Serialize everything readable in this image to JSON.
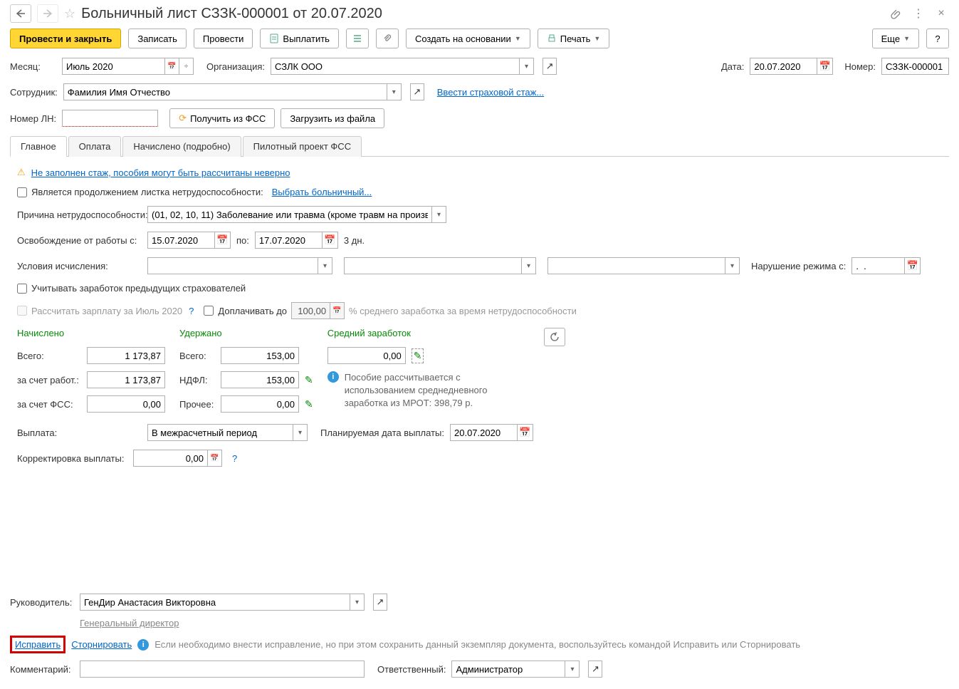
{
  "header": {
    "title": "Больничный лист СЗЗК-000001 от 20.07.2020"
  },
  "toolbar": {
    "post_close": "Провести и закрыть",
    "save": "Записать",
    "post": "Провести",
    "pay": "Выплатить",
    "create_based": "Создать на основании",
    "print": "Печать",
    "more": "Еще"
  },
  "fields": {
    "month_label": "Месяц:",
    "month_value": "Июль 2020",
    "org_label": "Организация:",
    "org_value": "СЗЛК ООО",
    "date_label": "Дата:",
    "date_value": "20.07.2020",
    "number_label": "Номер:",
    "number_value": "СЗЗК-000001",
    "employee_label": "Сотрудник:",
    "employee_value": "Фамилия Имя Отчество",
    "insurance_link": "Ввести страховой стаж...",
    "ln_label": "Номер ЛН:",
    "get_fss": "Получить из ФСС",
    "load_file": "Загрузить из файла"
  },
  "tabs": {
    "main": "Главное",
    "payment": "Оплата",
    "accrued": "Начислено (подробно)",
    "pilot": "Пилотный проект ФСС"
  },
  "main_tab": {
    "warning": "Не заполнен стаж, пособия могут быть рассчитаны неверно",
    "continuation_label": "Является продолжением листка нетрудоспособности:",
    "select_sick": "Выбрать больничный...",
    "reason_label": "Причина нетрудоспособности:",
    "reason_value": "(01, 02, 10, 11) Заболевание или травма (кроме травм на произв",
    "release_label": "Освобождение от работы с:",
    "release_from": "15.07.2020",
    "to_label": "по:",
    "release_to": "17.07.2020",
    "days": "3 дн.",
    "calc_conditions": "Условия исчисления:",
    "violation_label": "Нарушение режима с:",
    "violation_value": ".  .",
    "prev_employers": "Учитывать заработок предыдущих страхователей",
    "calc_salary": "Рассчитать зарплату за Июль 2020",
    "topup_label": "Доплачивать до",
    "topup_value": "100,00",
    "topup_suffix": "% среднего заработка за время нетрудоспособности"
  },
  "totals": {
    "accrued_hdr": "Начислено",
    "held_hdr": "Удержано",
    "avg_hdr": "Средний заработок",
    "total_label": "Всего:",
    "employer_label": "за счет работ.:",
    "fss_label": "за счет ФСС:",
    "ndfl_label": "НДФЛ:",
    "other_label": "Прочее:",
    "accrued_total": "1 173,87",
    "accrued_employer": "1 173,87",
    "accrued_fss": "0,00",
    "held_total": "153,00",
    "held_ndfl": "153,00",
    "held_other": "0,00",
    "avg_value": "0,00",
    "info_text": "Пособие рассчитывается с использованием среднедневного заработка из МРОТ: 398,79 р."
  },
  "payment_sec": {
    "label": "Выплата:",
    "value": "В межрасчетный период",
    "planned_label": "Планируемая дата выплаты:",
    "planned_value": "20.07.2020",
    "correction_label": "Корректировка выплаты:",
    "correction_value": "0,00"
  },
  "footer": {
    "manager_label": "Руководитель:",
    "manager_value": "ГенДир Анастасия Викторовна",
    "manager_position": "Генеральный директор",
    "fix": "Исправить",
    "storno": "Сторнировать",
    "fix_info": "Если необходимо внести исправление, но при этом сохранить данный экземпляр документа, воспользуйтесь командой Исправить или Сторнировать",
    "comment_label": "Комментарий:",
    "responsible_label": "Ответственный:",
    "responsible_value": "Администратор"
  }
}
